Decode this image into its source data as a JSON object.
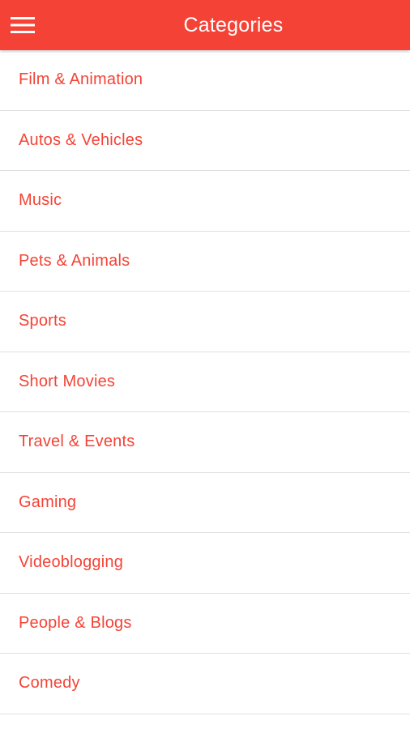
{
  "colors": {
    "accent": "#f44336",
    "toolbar_text": "#ffffff",
    "divider": "#e0e0e0"
  },
  "toolbar": {
    "menu_icon": "hamburger-menu-icon",
    "title": "Categories"
  },
  "categories": [
    {
      "label": "Film & Animation"
    },
    {
      "label": "Autos & Vehicles"
    },
    {
      "label": "Music"
    },
    {
      "label": "Pets & Animals"
    },
    {
      "label": "Sports"
    },
    {
      "label": "Short Movies"
    },
    {
      "label": "Travel & Events"
    },
    {
      "label": "Gaming"
    },
    {
      "label": "Videoblogging"
    },
    {
      "label": "People & Blogs"
    },
    {
      "label": "Comedy"
    }
  ]
}
